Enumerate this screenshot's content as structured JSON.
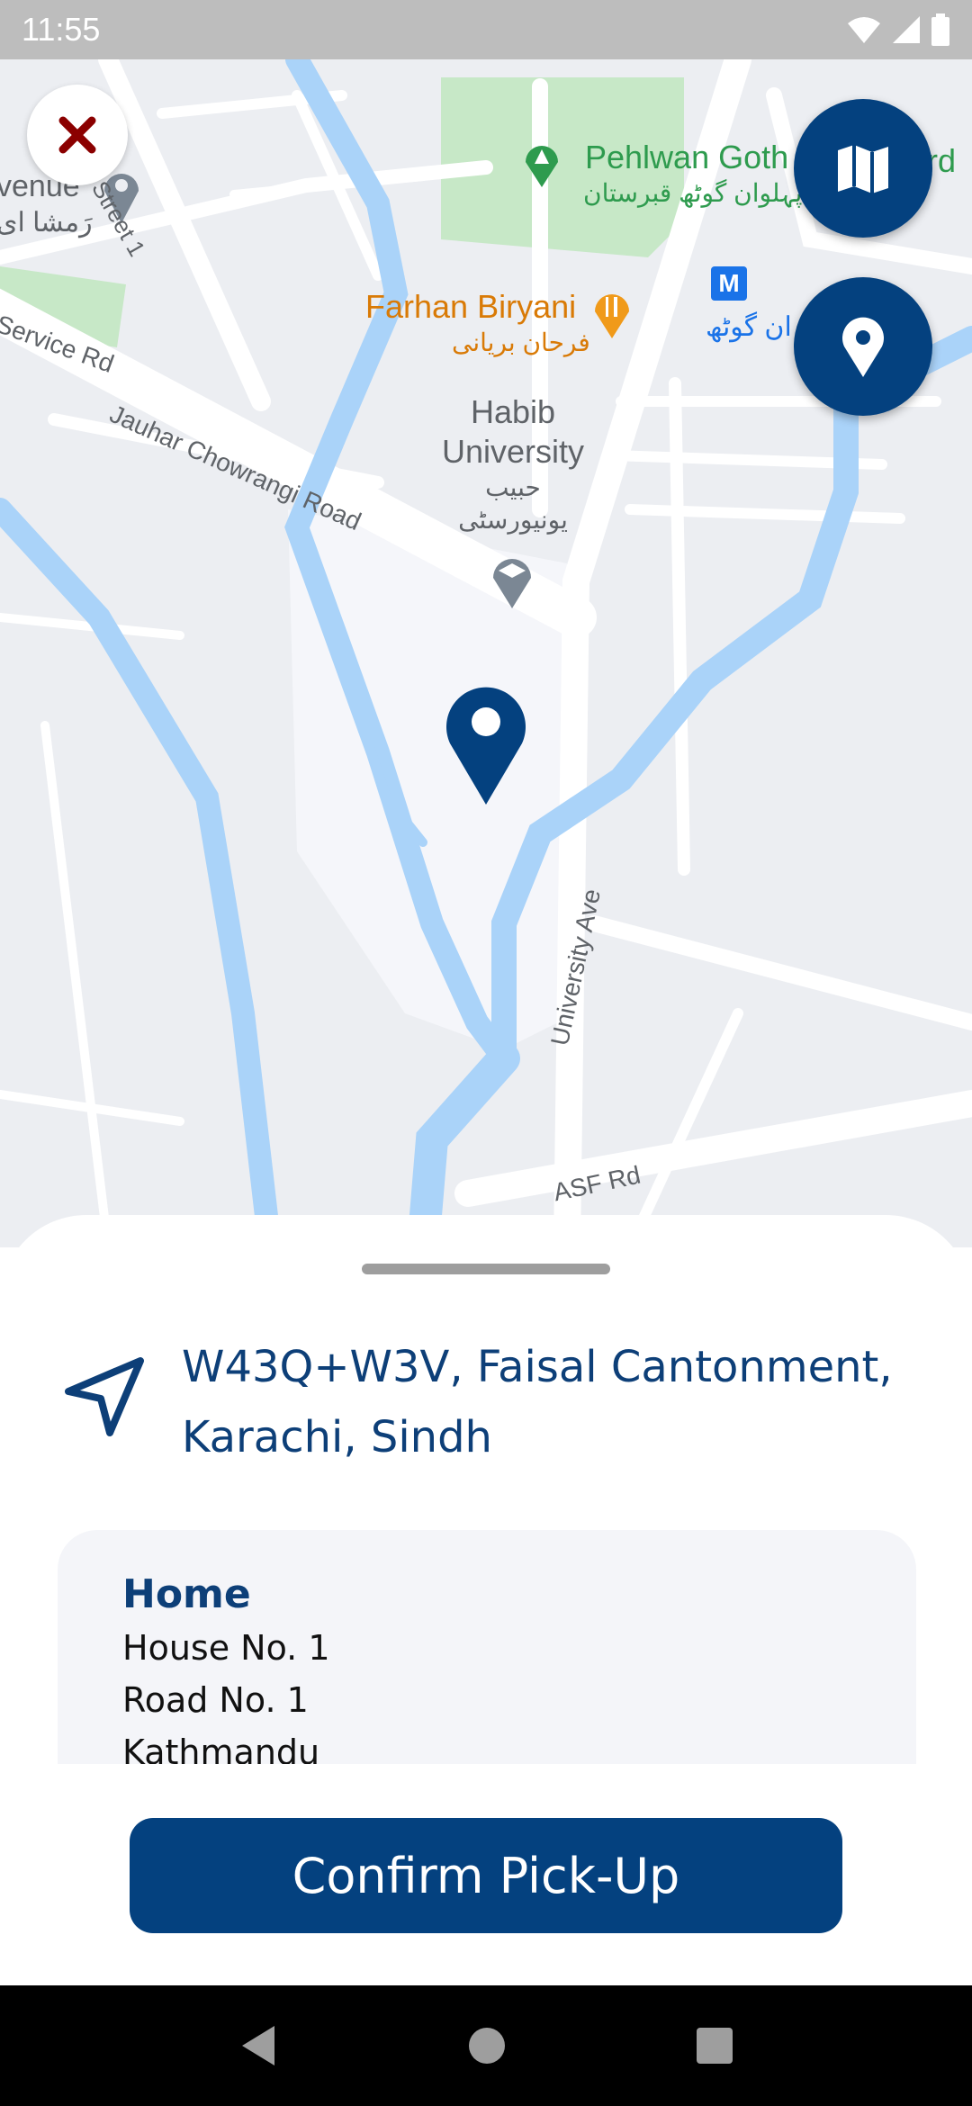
{
  "status_bar": {
    "time": "11:55"
  },
  "map": {
    "labels": {
      "pehlwan_en": "Pehlwan Goth",
      "pehlwan_ur": "پہلوان گوٹھ قبرستان",
      "farhan_en": "Farhan Biryani",
      "farhan_ur": "فرحان بریانی",
      "habib_en_1": "Habib",
      "habib_en_2": "University",
      "habib_ur_1": "حبیب",
      "habib_ur_2": "یونیورسٹی",
      "service_rd": "Service Rd",
      "jauhar_rd": "Jauhar Chowrangi Road",
      "street1": "Street 1",
      "university_ave": "University Ave",
      "asf_rd": "ASF Rd",
      "avenue": "venue",
      "ramsha": "رَمشا ای",
      "goth_right": "ان گوٹھ",
      "metro": "M",
      "rd_fragment": "rd"
    }
  },
  "colors": {
    "primary": "#04417f",
    "close": "#8b0000",
    "water": "#aad3f9",
    "park": "#c7e8c7"
  },
  "icons": {
    "close": "close-icon",
    "map": "map-icon",
    "location": "location-pin-icon",
    "navigation": "navigation-arrow-icon"
  },
  "sheet": {
    "address": "W43Q+W3V, Faisal Cantonment, Karachi, Sindh",
    "saved_address": {
      "title": "Home",
      "lines": [
        "House No. 1",
        "Road No. 1",
        "Kathmandu"
      ]
    },
    "confirm_label": "Confirm Pick-Up"
  }
}
